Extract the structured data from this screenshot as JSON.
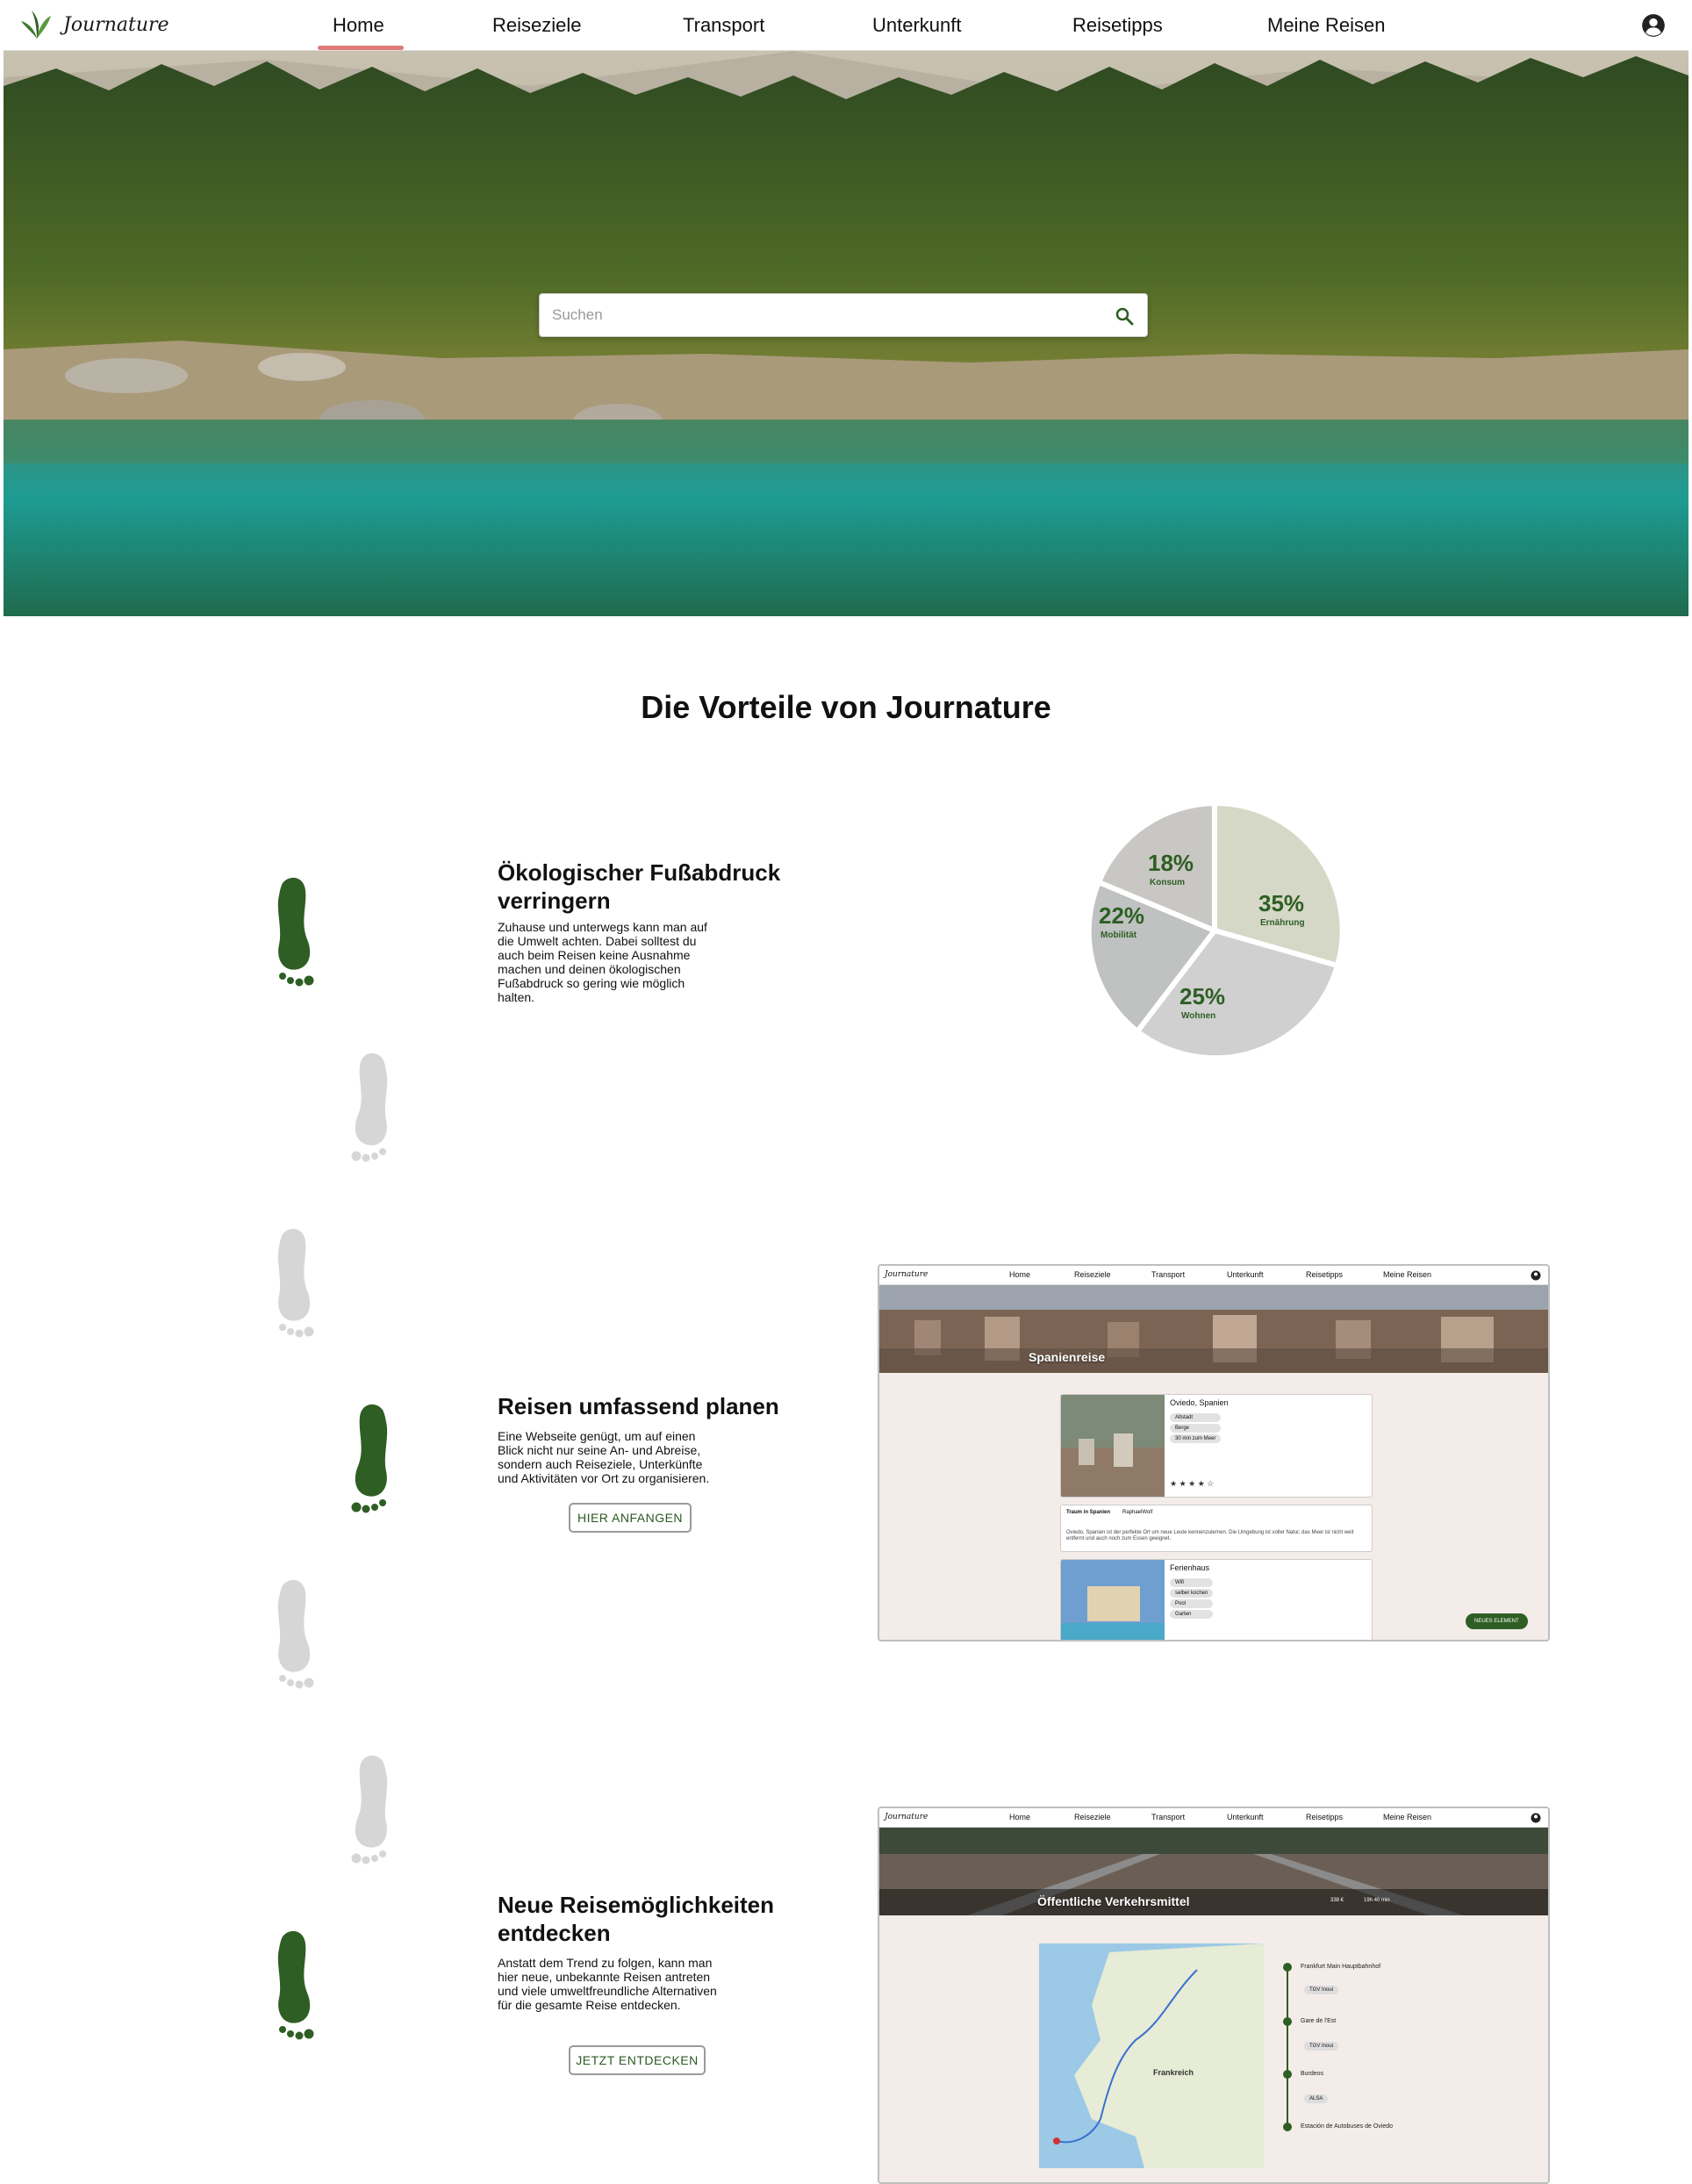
{
  "brand": {
    "name": "Journature"
  },
  "nav": {
    "items": [
      "Home",
      "Reiseziele",
      "Transport",
      "Unterkunft",
      "Reisetipps",
      "Meine Reisen"
    ],
    "active": "Home"
  },
  "search": {
    "placeholder": "Suchen"
  },
  "section": {
    "title": "Die Vorteile von Journature"
  },
  "features": [
    {
      "title": "Ökologischer Fußabdruck verringern",
      "text": "Zuhause und unterwegs kann man auf die Umwelt achten. Dabei solltest du auch beim Reisen keine Ausnahme machen und deinen ökologischen Fußabdruck so gering wie möglich halten."
    },
    {
      "title": "Reisen umfassend planen",
      "text": "Eine Webseite genügt, um auf einen Blick nicht nur seine An- und Abreise, sondern auch Reiseziele, Unterkünfte und Aktivitäten vor Ort zu organisieren.",
      "button": "HIER ANFANGEN"
    },
    {
      "title": "Neue Reisemöglichkeiten entdecken",
      "text": "Anstatt dem Trend zu folgen, kann man hier neue, unbekannte Reisen antreten und viele umweltfreundliche Alternativen für die gesamte Reise entdecken.",
      "button": "JETZT ENTDECKEN"
    }
  ],
  "pie": {
    "slices": [
      {
        "label": "Konsum",
        "percent": "18%",
        "value": 18
      },
      {
        "label": "Ernährung",
        "percent": "35%",
        "value": 35
      },
      {
        "label": "Wohnen",
        "percent": "25%",
        "value": 25
      },
      {
        "label": "Mobilität",
        "percent": "22%",
        "value": 22
      }
    ]
  },
  "mock1": {
    "hero_title": "Spanienreise",
    "card1": {
      "title": "Oviedo, Spanien",
      "chips": [
        "Altstadt",
        "Berge",
        "30 min zum Meer"
      ]
    },
    "note": {
      "title": "Traum in Spanien",
      "user": "RaphaelWolf",
      "text": "Oviedo, Spanien ist der perfekte Ort um neue Leute kennenzulernen. Die Umgebung ist voller Natur, das Meer ist nicht weit entfernt und auch noch zum Essen geeignet."
    },
    "card2": {
      "title": "Ferienhaus",
      "chips": [
        "Wifi",
        "selber kochen",
        "Pool",
        "Garten"
      ]
    },
    "fab": "NEUES ELEMENT"
  },
  "mock2": {
    "hero_title": "Öffentliche Verkehrsmittel",
    "price": "338 €",
    "duration": "19h 40 min",
    "map_label": "Frankreich",
    "stops": [
      "Frankfurt Main Hauptbahnhof",
      "Gare de l'Est",
      "Burdeos",
      "Estación de Autobuses de Oviedo"
    ],
    "legs": [
      "TGV Inoui",
      "TGV Inoui",
      "ALSA"
    ]
  },
  "colors": {
    "accent_green": "#2e5e24",
    "foot_grey": "#d6d6d6",
    "nav_active": "#e07a7a"
  }
}
